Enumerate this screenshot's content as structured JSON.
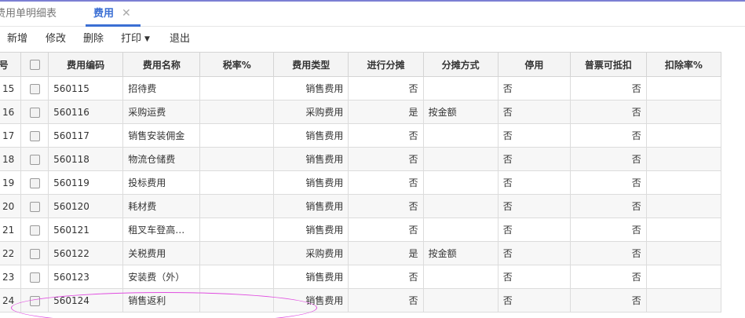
{
  "tabs": {
    "doc_tab_label": "费用单明细表",
    "active_tab_label": "费用",
    "close_glyph": "✕"
  },
  "toolbar": {
    "new_label": "新增",
    "edit_label": "修改",
    "delete_label": "删除",
    "print_label": "打印",
    "exit_label": "退出"
  },
  "table": {
    "columns": [
      "序号",
      "",
      "费用编码",
      "费用名称",
      "税率%",
      "费用类型",
      "进行分摊",
      "分摊方式",
      "停用",
      "普票可抵扣",
      "扣除率%"
    ],
    "rows": [
      {
        "no": "15",
        "code": "560115",
        "name": "招待费",
        "tax": "",
        "type": "销售费用",
        "alloc": "否",
        "method": "",
        "disabled": "否",
        "deductible": "否",
        "rate": ""
      },
      {
        "no": "16",
        "code": "560116",
        "name": "采购运费",
        "tax": "",
        "type": "采购费用",
        "alloc": "是",
        "method": "按金额",
        "disabled": "否",
        "deductible": "否",
        "rate": ""
      },
      {
        "no": "17",
        "code": "560117",
        "name": "销售安装佣金",
        "tax": "",
        "type": "销售费用",
        "alloc": "否",
        "method": "",
        "disabled": "否",
        "deductible": "否",
        "rate": ""
      },
      {
        "no": "18",
        "code": "560118",
        "name": "物流仓储费",
        "tax": "",
        "type": "销售费用",
        "alloc": "否",
        "method": "",
        "disabled": "否",
        "deductible": "否",
        "rate": ""
      },
      {
        "no": "19",
        "code": "560119",
        "name": "投标费用",
        "tax": "",
        "type": "销售费用",
        "alloc": "否",
        "method": "",
        "disabled": "否",
        "deductible": "否",
        "rate": ""
      },
      {
        "no": "20",
        "code": "560120",
        "name": "耗材费",
        "tax": "",
        "type": "销售费用",
        "alloc": "否",
        "method": "",
        "disabled": "否",
        "deductible": "否",
        "rate": ""
      },
      {
        "no": "21",
        "code": "560121",
        "name": "租叉车登高…",
        "tax": "",
        "type": "销售费用",
        "alloc": "否",
        "method": "",
        "disabled": "否",
        "deductible": "否",
        "rate": ""
      },
      {
        "no": "22",
        "code": "560122",
        "name": "关税费用",
        "tax": "",
        "type": "采购费用",
        "alloc": "是",
        "method": "按金额",
        "disabled": "否",
        "deductible": "否",
        "rate": ""
      },
      {
        "no": "23",
        "code": "560123",
        "name": "安装费（外）",
        "tax": "",
        "type": "销售费用",
        "alloc": "否",
        "method": "",
        "disabled": "否",
        "deductible": "否",
        "rate": ""
      },
      {
        "no": "24",
        "code": "560124",
        "name": "销售返利",
        "tax": "",
        "type": "销售费用",
        "alloc": "否",
        "method": "",
        "disabled": "否",
        "deductible": "否",
        "rate": ""
      }
    ]
  },
  "colors": {
    "accent": "#3b6fd4",
    "annotation": "#e04ee0"
  }
}
